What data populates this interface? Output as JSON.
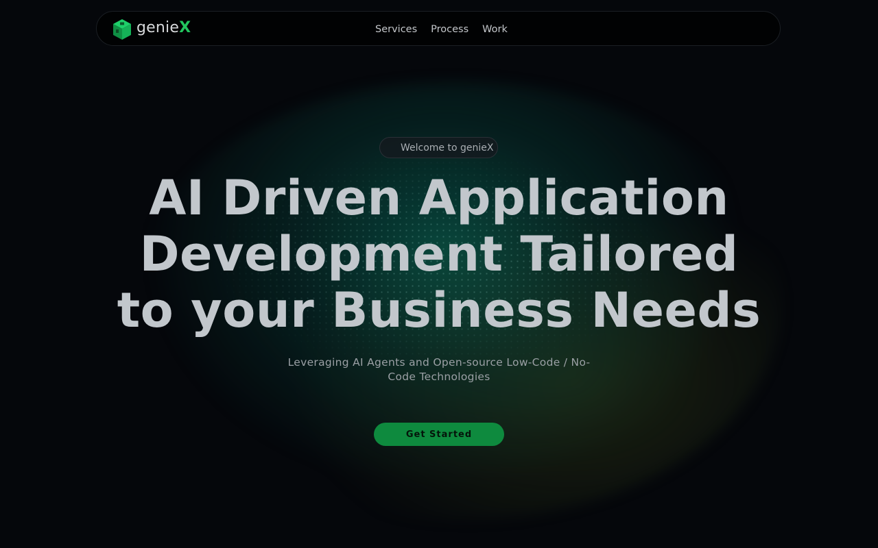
{
  "brand": {
    "name_prefix": "genie",
    "name_suffix": "X",
    "accent_color": "#22c55e",
    "logo_icon": "cube-icon"
  },
  "nav": {
    "links": [
      {
        "label": "Services"
      },
      {
        "label": "Process"
      },
      {
        "label": "Work"
      }
    ]
  },
  "hero": {
    "badge": "Welcome to genieX",
    "title_lines": [
      "AI Driven Application",
      "Development Tailored",
      "to your Business Needs"
    ],
    "subtitle": "Leveraging AI Agents and Open-source Low-Code / No-Code Technologies",
    "cta_label": "Get Started",
    "cta_color": "#0e8a3e"
  },
  "colors": {
    "background": "#05070b",
    "glow": "#0a7864"
  }
}
